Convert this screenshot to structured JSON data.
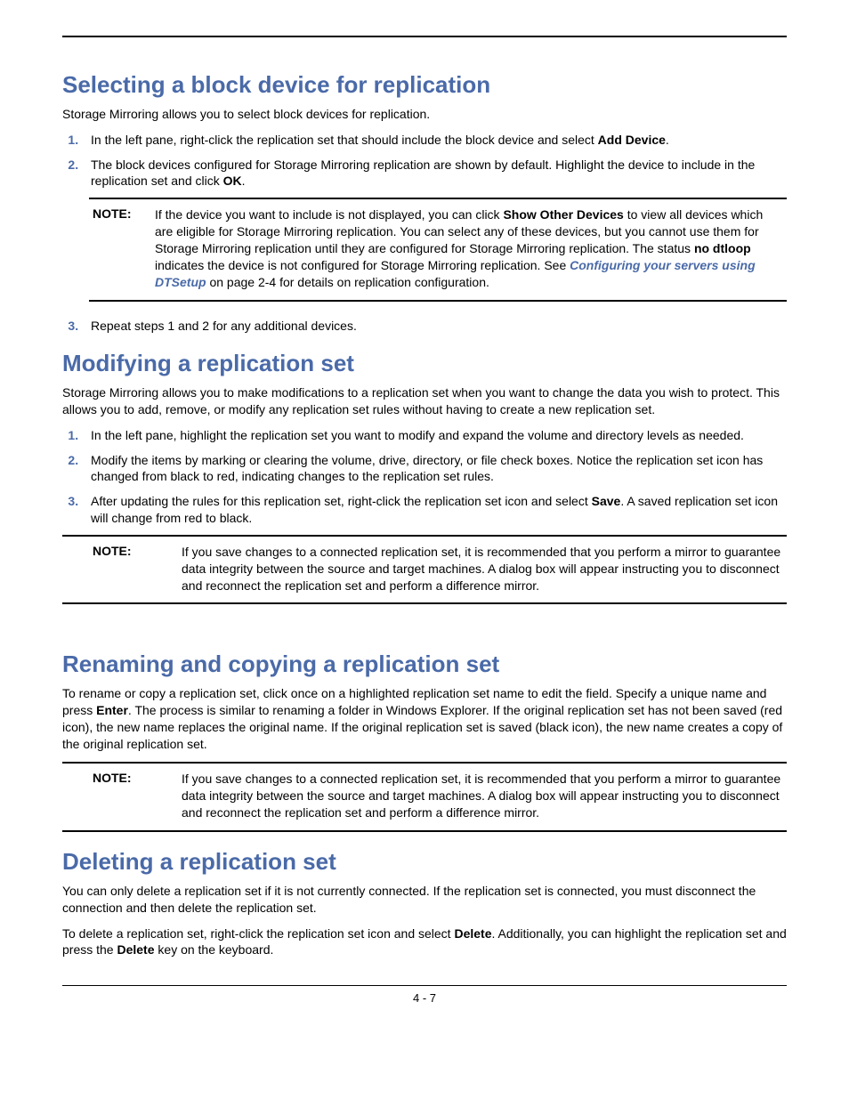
{
  "sections": {
    "s1": {
      "heading": "Selecting a block device for replication",
      "intro": "Storage Mirroring allows you to select block devices for replication.",
      "step1_a": "In the left pane, right-click the replication set that should include the block device and select ",
      "step1_b": "Add Device",
      "step1_c": ".",
      "step2_a": "The block devices configured for Storage Mirroring replication are shown by default. Highlight the device to include in the replication set and click ",
      "step2_b": "OK",
      "step2_c": ".",
      "note_label": "NOTE:",
      "note_a": "If the device you want to include is not displayed, you can click ",
      "note_b": "Show Other Devices",
      "note_c": " to view all devices which are eligible for Storage Mirroring replication. You can select any of these devices, but you cannot use them for Storage Mirroring replication until they are configured for Storage Mirroring replication. The status ",
      "note_d": "no dtloop",
      "note_e": " indicates the device is not configured for Storage Mirroring replication. See ",
      "note_link": "Configuring your servers using DTSetup",
      "note_f": " on page 2-4 for details on replication configuration.",
      "step3": "Repeat steps 1 and 2 for any additional devices."
    },
    "s2": {
      "heading": "Modifying a replication set",
      "intro": "Storage Mirroring allows you to make modifications to a replication set when you want to change the data you wish to protect. This allows you to add, remove, or modify any replication set rules without having to create a new replication set.",
      "step1": "In the left pane, highlight the replication set you want to modify and expand the volume and directory levels as needed.",
      "step2": "Modify the items by marking or clearing the volume, drive, directory, or file check boxes. Notice the replication set icon has changed from black to red, indicating changes to the replication set rules.",
      "step3_a": "After updating the rules for this replication set, right-click the replication set icon and select ",
      "step3_b": "Save",
      "step3_c": ". A saved replication set icon will change from red to black.",
      "note_label": "NOTE:",
      "note_body": "If you save changes to a connected replication set, it is recommended that you perform a mirror to guarantee data integrity between the source and target machines. A dialog box will appear instructing you to disconnect and reconnect the replication set and perform a difference mirror."
    },
    "s3": {
      "heading": "Renaming and copying a replication set",
      "intro_a": "To rename or copy a replication set, click once on a highlighted replication set name to edit the field. Specify a unique name and press ",
      "intro_b": "Enter",
      "intro_c": ". The process is similar to renaming a folder in Windows Explorer.  If the original replication set has not been saved (red icon), the new name replaces the original name. If the original replication set is saved (black icon), the new name creates a copy of the original replication set.",
      "note_label": "NOTE:",
      "note_body": "If you save changes to a connected replication set, it is recommended that you perform a mirror to guarantee data integrity between the source and target machines. A dialog box will appear instructing you to disconnect and reconnect the replication set and perform a difference mirror."
    },
    "s4": {
      "heading": "Deleting a replication set",
      "p1": "You can only delete a replication set if it is not currently connected. If the replication set is connected, you must disconnect the connection and then delete the replication set.",
      "p2_a": "To delete a replication set, right-click the replication set icon and select ",
      "p2_b": "Delete",
      "p2_c": ". Additionally, you can highlight the replication set and press the ",
      "p2_d": "Delete",
      "p2_e": " key on the keyboard."
    }
  },
  "footer": "4 - 7"
}
